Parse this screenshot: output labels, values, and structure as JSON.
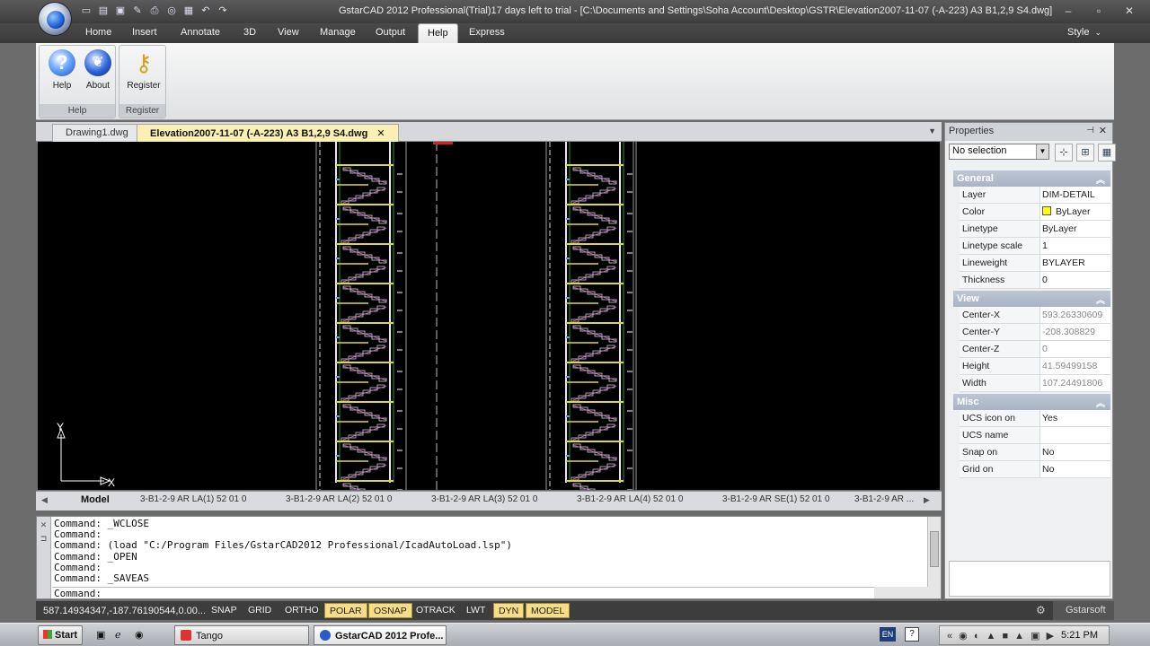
{
  "window": {
    "title": "GstarCAD 2012 Professional(Trial)17 days left to trial - [C:\\Documents and Settings\\Soha Account\\Desktop\\GSTR\\Elevation2007-11-07 (-A-223) A3 B1,2,9 S4.dwg]",
    "buttons": [
      "–",
      "▫",
      "✕"
    ]
  },
  "quick_access": [
    "new-icon",
    "open-icon",
    "save-icon",
    "saveas-icon",
    "print-icon",
    "preview-icon",
    "publish-icon",
    "undo-icon",
    "redo-icon"
  ],
  "ribbon": {
    "tabs": [
      "Home",
      "Insert",
      "Annotate",
      "3D",
      "View",
      "Manage",
      "Output",
      "Help",
      "Express"
    ],
    "active_tab": "Help",
    "style_label": "Style",
    "groups": [
      {
        "caption": "Help",
        "buttons": [
          {
            "label": "Help",
            "icon": "help-icon"
          },
          {
            "label": "About",
            "icon": "about-icon"
          }
        ]
      },
      {
        "caption": "Register",
        "buttons": [
          {
            "label": "Register",
            "icon": "key-icon"
          }
        ]
      }
    ]
  },
  "document_tabs": [
    {
      "label": "Drawing1.dwg",
      "active": false
    },
    {
      "label": "Elevation2007-11-07 (-A-223) A3 B1,2,9 S4.dwg",
      "active": true,
      "close": "✕"
    }
  ],
  "canvas": {
    "background": "#000000",
    "ucs": {
      "x_label": "X",
      "y_label": "Y"
    }
  },
  "layout_tabs": [
    "Model",
    "3-B1-2-9 AR LA(1) 52 01 0",
    "3-B1-2-9 AR LA(2) 52 01 0",
    "3-B1-2-9 AR LA(3) 52 01 0",
    "3-B1-2-9 AR LA(4) 52 01 0",
    "3-B1-2-9 AR SE(1) 52 01 0",
    "3-B1-2-9 AR ..."
  ],
  "command": {
    "lines": [
      "Command: _WCLOSE",
      "Command:",
      "Command: (load \"C:/Program Files/GstarCAD2012 Professional/IcadAutoLoad.lsp\")",
      "Command: _OPEN",
      "Command:",
      "Command: _SAVEAS"
    ],
    "prompt": "Command:"
  },
  "properties": {
    "title": "Properties",
    "selection": "No selection",
    "sections": [
      {
        "name": "General",
        "rows": [
          {
            "key": "Layer",
            "value": "DIM-DETAIL"
          },
          {
            "key": "Color",
            "value": "ByLayer",
            "swatch": "#ffff00"
          },
          {
            "key": "Linetype",
            "value": "ByLayer"
          },
          {
            "key": "Linetype scale",
            "value": "1"
          },
          {
            "key": "Lineweight",
            "value": "BYLAYER"
          },
          {
            "key": "Thickness",
            "value": "0"
          }
        ]
      },
      {
        "name": "View",
        "rows": [
          {
            "key": "Center-X",
            "value": "593.26330609",
            "greyed": true
          },
          {
            "key": "Center-Y",
            "value": "-208.308829",
            "greyed": true
          },
          {
            "key": "Center-Z",
            "value": "0",
            "greyed": true
          },
          {
            "key": "Height",
            "value": "41.59499158",
            "greyed": true
          },
          {
            "key": "Width",
            "value": "107.24491806",
            "greyed": true
          }
        ]
      },
      {
        "name": "Misc",
        "rows": [
          {
            "key": "UCS icon on",
            "value": "Yes"
          },
          {
            "key": "UCS name",
            "value": ""
          },
          {
            "key": "Snap on",
            "value": "No"
          },
          {
            "key": "Grid on",
            "value": "No"
          }
        ]
      }
    ]
  },
  "statusbar": {
    "coords": "587.14934347,-187.76190544,0.00...",
    "toggles": [
      {
        "label": "SNAP",
        "on": false
      },
      {
        "label": "GRID",
        "on": false
      },
      {
        "label": "ORTHO",
        "on": false
      },
      {
        "label": "POLAR",
        "on": true
      },
      {
        "label": "OSNAP",
        "on": true
      },
      {
        "label": "OTRACK",
        "on": false
      },
      {
        "label": "LWT",
        "on": false
      },
      {
        "label": "DYN",
        "on": true
      },
      {
        "label": "MODEL",
        "on": true
      }
    ],
    "brand": "Gstarsoft"
  },
  "taskbar": {
    "start": "Start",
    "tasks": [
      {
        "label": "Tango",
        "active": false,
        "color": "#d33"
      },
      {
        "label": "GstarCAD 2012 Profe...",
        "active": true,
        "color": "#2a5cc8"
      }
    ],
    "lang": "EN",
    "clock": "5:21 PM"
  }
}
